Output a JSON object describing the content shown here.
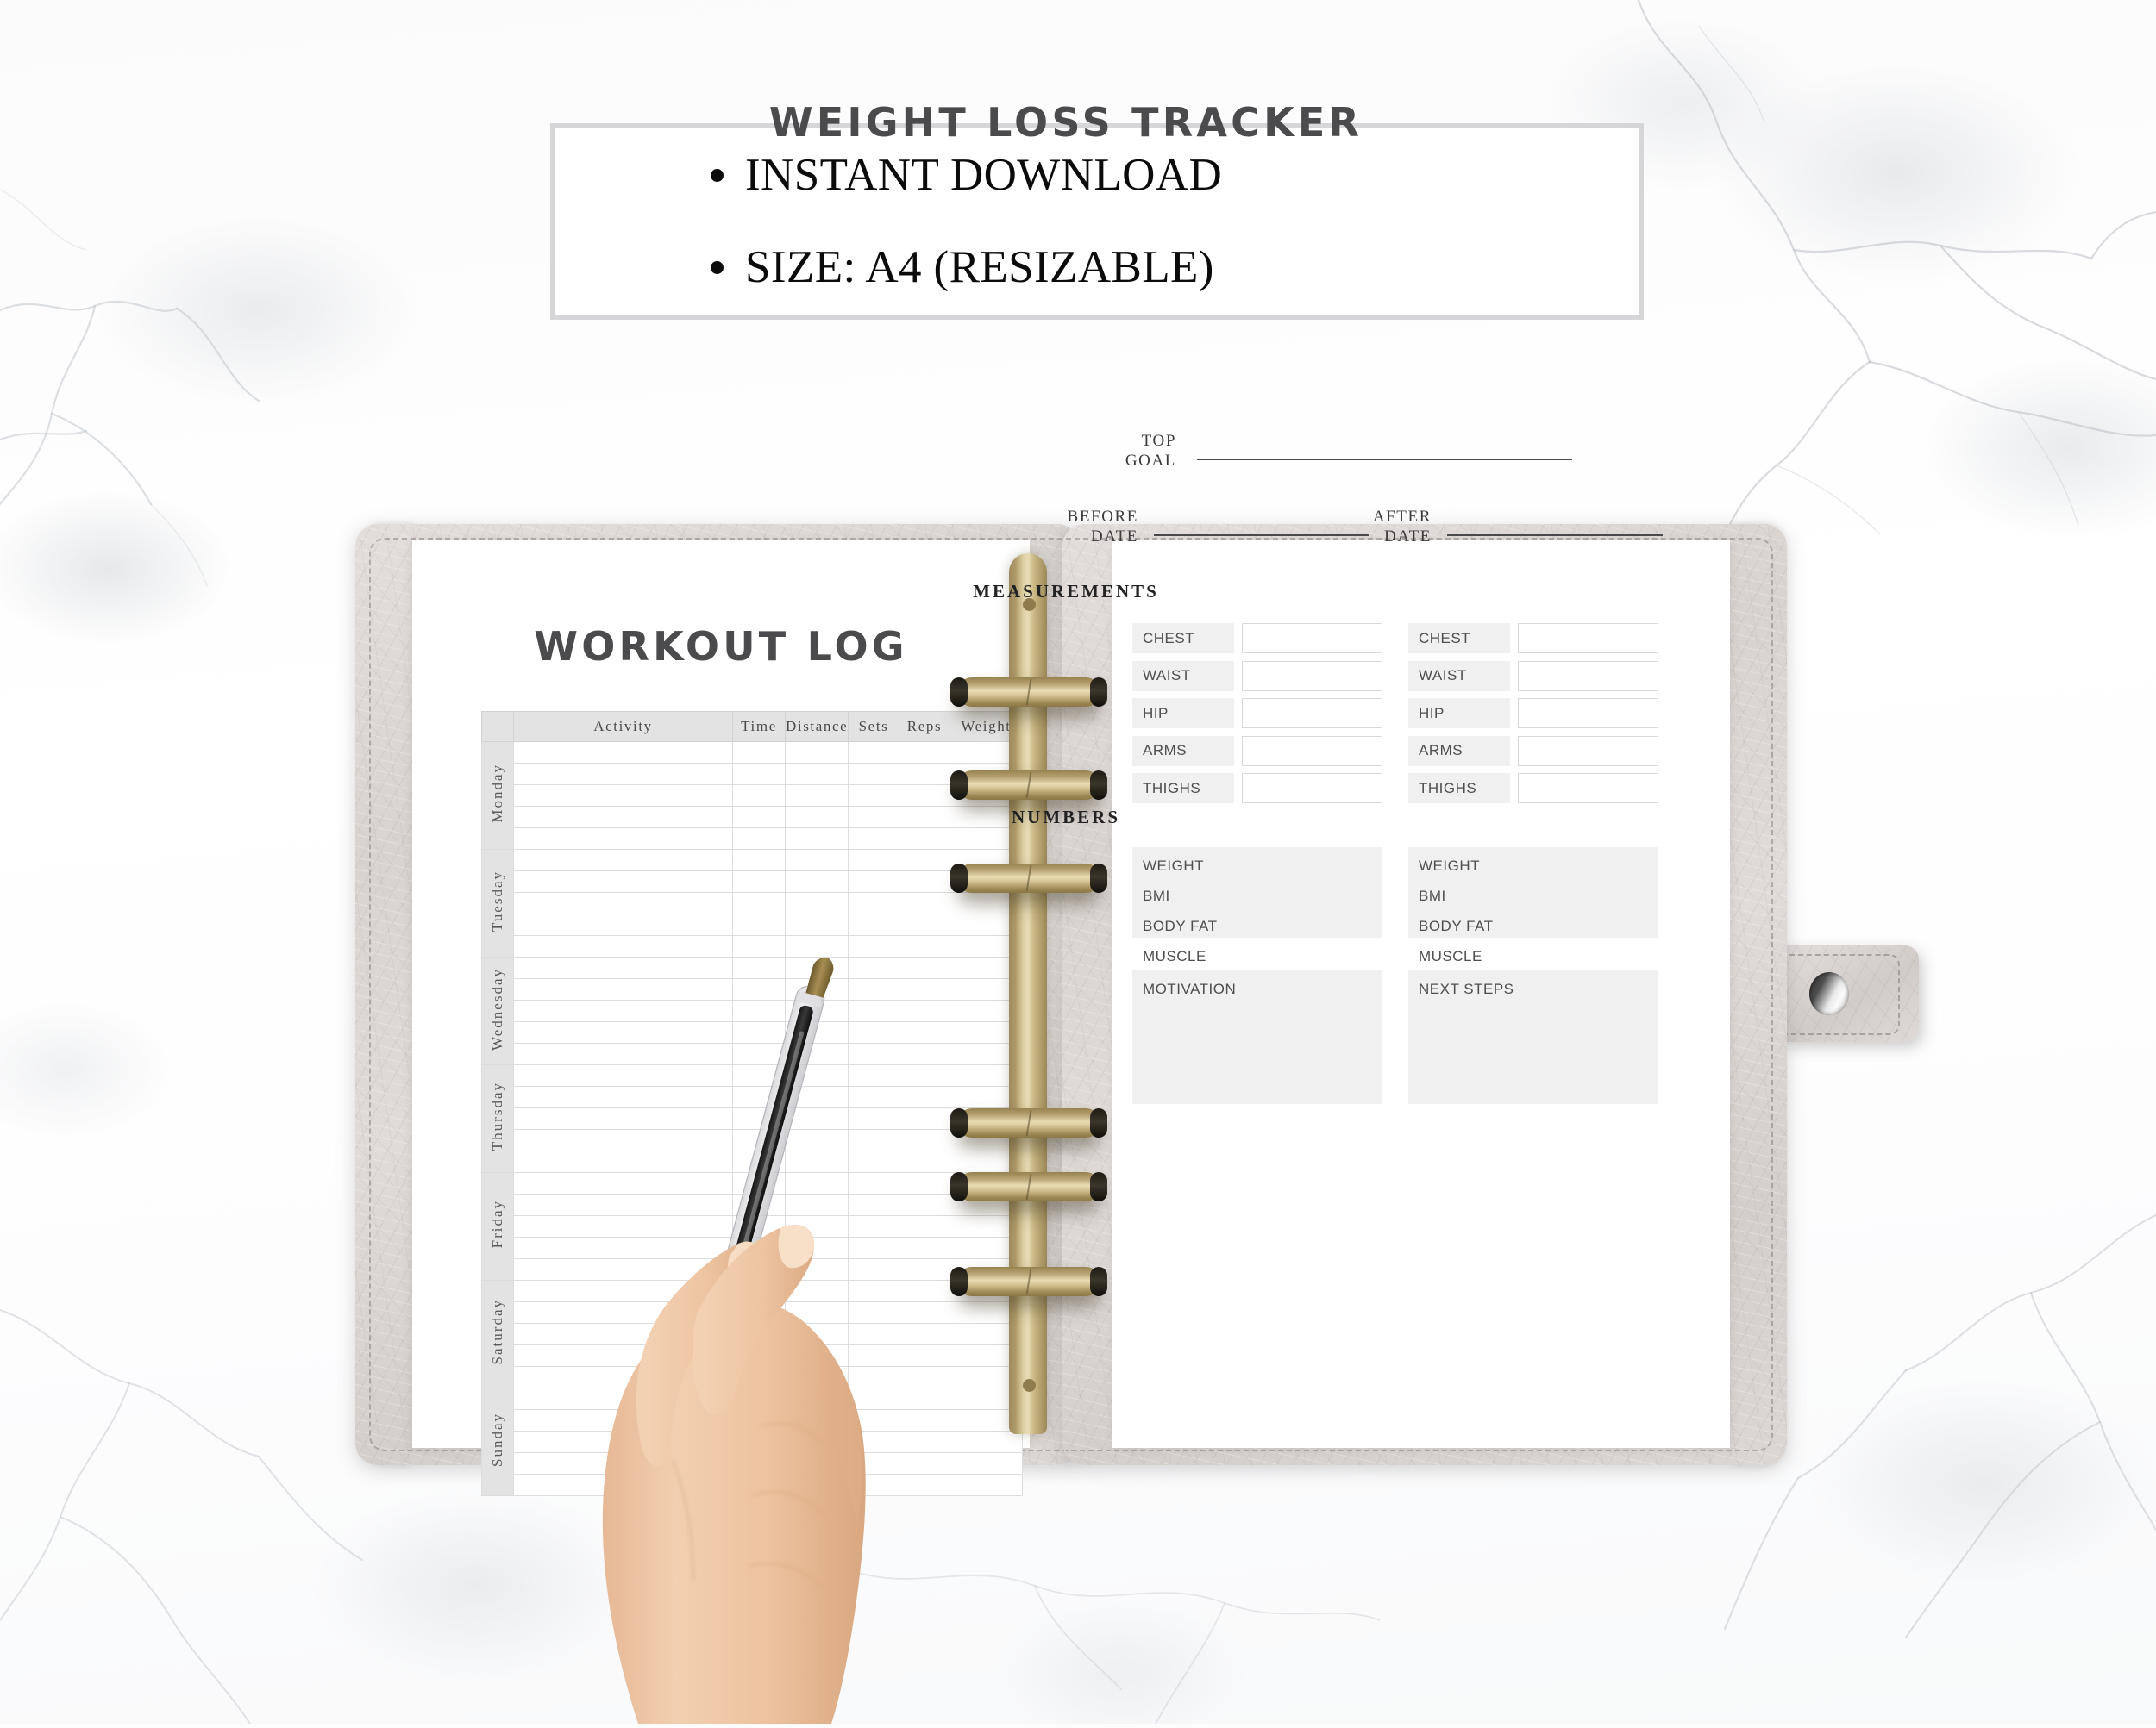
{
  "promo": {
    "lines": [
      "INSTANT DOWNLOAD",
      "SIZE: A4 (RESIZABLE)"
    ]
  },
  "colors": {
    "heading": "#4b4b4d",
    "rule": "#4a4a4c",
    "table_header_bg": "#e3e3e3",
    "field_bg": "#f0f0f0",
    "field_border": "#d8d8d8",
    "ring_gold": "#d3c192",
    "cover_leather": "#ded9d6",
    "box_border": "#d6d6d8"
  },
  "workout_log": {
    "title": "WORKOUT LOG",
    "columns": [
      "Activity",
      "Time",
      "Distance",
      "Sets",
      "Reps",
      "Weight"
    ],
    "days": [
      "Monday",
      "Tuesday",
      "Wednesday",
      "Thursday",
      "Friday",
      "Saturday",
      "Sunday"
    ],
    "rows_per_day": 5
  },
  "weight_tracker": {
    "title": "WEIGHT LOSS TRACKER",
    "top_goal_label": "TOP\nGOAL",
    "top_goal_label_line1": "TOP",
    "top_goal_label_line2": "GOAL",
    "before_date_line1": "BEFORE",
    "before_date_line2": "DATE",
    "after_date_line1": "AFTER",
    "after_date_line2": "DATE",
    "measurements_heading": "MEASUREMENTS",
    "numbers_heading": "NUMBERS",
    "measurement_labels": [
      "CHEST",
      "WAIST",
      "HIP",
      "ARMS",
      "THIGHS"
    ],
    "number_labels": [
      "WEIGHT",
      "BMI",
      "BODY FAT",
      "MUSCLE"
    ],
    "motivation_label": "MOTIVATION",
    "next_steps_label": "NEXT STEPS"
  }
}
